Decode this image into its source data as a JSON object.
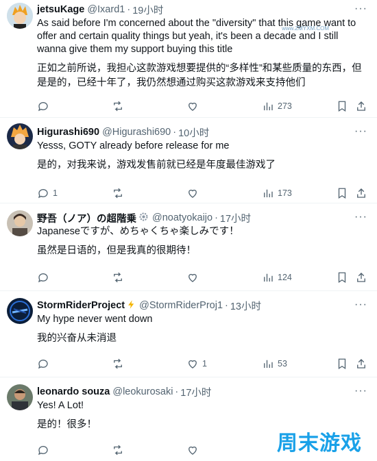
{
  "tweets": [
    {
      "name": "jetsuKage",
      "handle": "@Ixard1",
      "time": "19小时",
      "text": "As said before I'm concerned about the \"diversity\" that this game want to offer and certain quality things but yeah, it's been a decade and I still wanna give them my support buying this title",
      "translation": "正如之前所说，我担心这款游戏想要提供的“多样性”和某些质量的东西，但是是的，已经十年了，我仍然想通过购买这款游戏来支持他们",
      "replies": "",
      "views": "273",
      "likes": ""
    },
    {
      "name": "Higurashi690",
      "handle": "@Higurashi690",
      "time": "10小时",
      "text": "Yesss, GOTY already before release for me",
      "translation": "是的，对我来说，游戏发售前就已经是年度最佳游戏了",
      "replies": "1",
      "views": "173",
      "likes": ""
    },
    {
      "name": "野吾（ノア）の超階乗",
      "handle": "@noatyokaijo",
      "time": "17小时",
      "text": "Japaneseですが、めちゃくちゃ楽しみです！",
      "translation": "虽然是日语的，但是我真的很期待！",
      "replies": "",
      "views": "124",
      "likes": ""
    },
    {
      "name": "StormRiderProject",
      "handle": "@StormRiderProj1",
      "time": "13小时",
      "text": "My hype never went down",
      "translation": "我的兴奋从未消退",
      "replies": "",
      "views": "53",
      "likes": "1"
    },
    {
      "name": "leonardo souza",
      "handle": "@leokurosaki",
      "time": "17小时",
      "text": "Yes! A Lot!",
      "translation": "是的！很多！",
      "replies": "",
      "views": "",
      "likes": ""
    }
  ],
  "separator": "·",
  "more_glyph": "···",
  "watermark": {
    "text": "周末游戏",
    "url": "www.ZMYXM.COM"
  },
  "colors": {
    "secondary": "#536471",
    "text": "#0f1419",
    "border": "#eff3f4",
    "watermark": "#1aa1e8"
  }
}
